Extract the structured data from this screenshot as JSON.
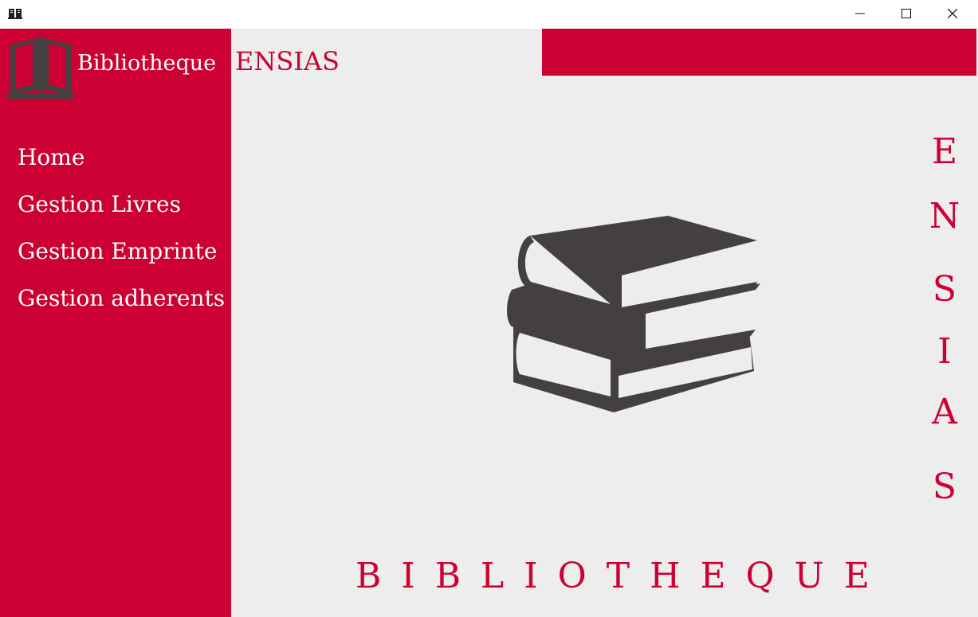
{
  "window": {
    "icon": "book-open-icon",
    "controls": [
      "minimize-icon",
      "maximize-icon",
      "close-icon"
    ]
  },
  "sidebar": {
    "brand": "Bibliotheque",
    "logo_icon": "book-open-icon",
    "items": [
      {
        "label": "Home"
      },
      {
        "label": "Gestion Livres"
      },
      {
        "label": "Gestion Emprinte"
      },
      {
        "label": "Gestion adherents"
      }
    ]
  },
  "header": {
    "title": "ENSIAS"
  },
  "main": {
    "illustration": "books-stack-icon",
    "vertical_letters": [
      "E",
      "N",
      "S",
      "I",
      "A",
      "S"
    ],
    "bottom_title": "BIBLIOTHEQUE"
  },
  "colors": {
    "accent": "#cc0033",
    "background": "#ededed",
    "icon_dark": "#444041"
  }
}
